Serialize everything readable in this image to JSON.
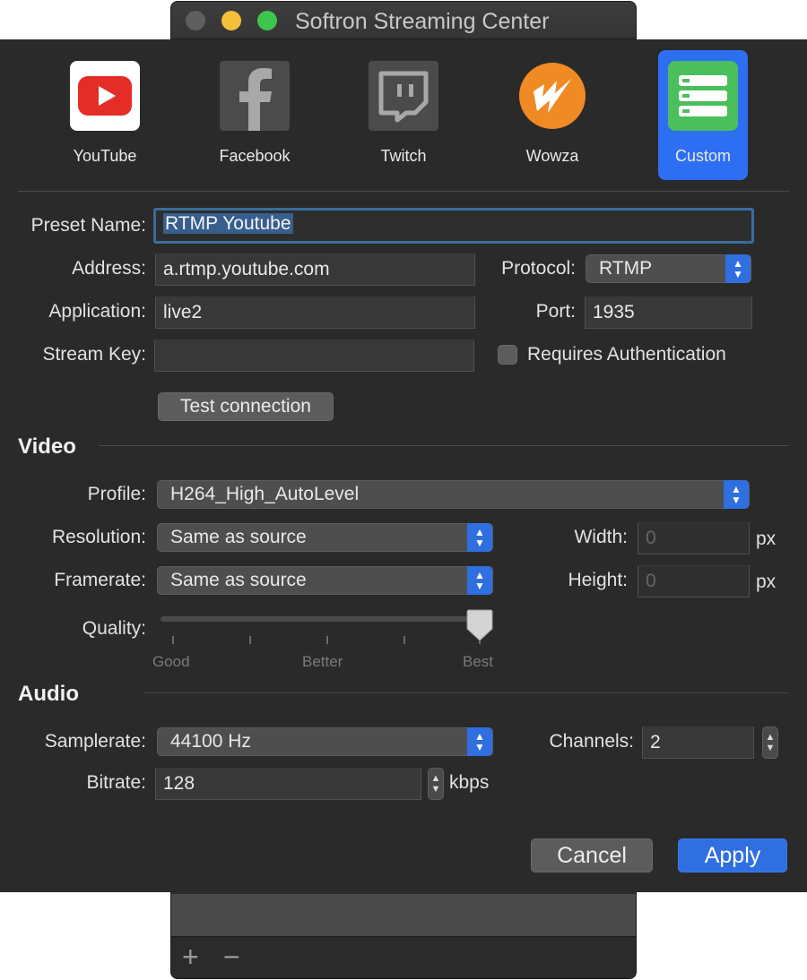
{
  "window": {
    "title": "Softron Streaming Center"
  },
  "services": [
    {
      "label": "YouTube",
      "icon": "youtube-icon",
      "color": "#e52d27"
    },
    {
      "label": "Facebook",
      "icon": "facebook-icon",
      "color": "#4b4b4b"
    },
    {
      "label": "Twitch",
      "icon": "twitch-icon",
      "color": "#4b4b4b"
    },
    {
      "label": "Wowza",
      "icon": "wowza-icon",
      "color": "#f08a24"
    },
    {
      "label": "Custom",
      "icon": "server-list-icon",
      "color": "#4bbf5c",
      "selected": true
    }
  ],
  "connection": {
    "preset_label": "Preset Name:",
    "preset_value": "RTMP Youtube",
    "address_label": "Address:",
    "address_value": "a.rtmp.youtube.com",
    "protocol_label": "Protocol:",
    "protocol_value": "RTMP",
    "application_label": "Application:",
    "application_value": "live2",
    "port_label": "Port:",
    "port_value": "1935",
    "stream_key_label": "Stream Key:",
    "stream_key_value": "",
    "auth_label": "Requires Authentication",
    "auth_checked": false,
    "test_button": "Test connection"
  },
  "video": {
    "section_title": "Video",
    "profile_label": "Profile:",
    "profile_value": "H264_High_AutoLevel",
    "resolution_label": "Resolution:",
    "resolution_value": "Same as source",
    "framerate_label": "Framerate:",
    "framerate_value": "Same as source",
    "width_label": "Width:",
    "width_value": "0",
    "height_label": "Height:",
    "height_value": "0",
    "px_unit": "px",
    "quality_label": "Quality:",
    "quality_ticks": [
      "Good",
      "Better",
      "Best"
    ],
    "quality_level": 1.0
  },
  "audio": {
    "section_title": "Audio",
    "samplerate_label": "Samplerate:",
    "samplerate_value": "44100 Hz",
    "channels_label": "Channels:",
    "channels_value": "2",
    "bitrate_label": "Bitrate:",
    "bitrate_value": "128",
    "bitrate_unit": "kbps"
  },
  "actions": {
    "cancel": "Cancel",
    "apply": "Apply"
  },
  "footer": {
    "add": "+",
    "remove": "−"
  },
  "colors": {
    "accent": "#2f6fe0",
    "sheet_bg": "#2a2a2a",
    "focus_ring": "#3b6c9c"
  }
}
